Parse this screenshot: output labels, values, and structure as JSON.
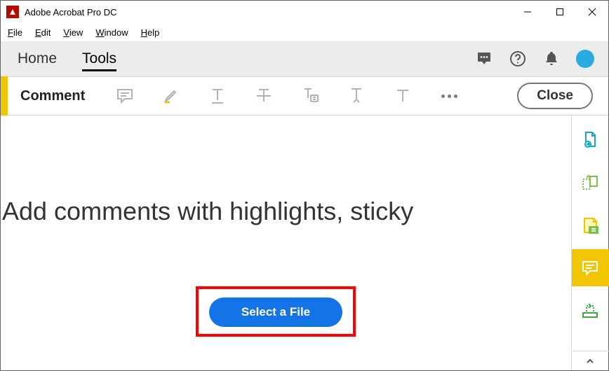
{
  "window": {
    "title": "Adobe Acrobat Pro DC"
  },
  "menubar": {
    "items": [
      "File",
      "Edit",
      "View",
      "Window",
      "Help"
    ]
  },
  "tabs": {
    "home": "Home",
    "tools": "Tools"
  },
  "toolbar": {
    "label": "Comment",
    "close_label": "Close"
  },
  "main": {
    "headline": "Add comments with highlights, sticky",
    "select_file_label": "Select a File"
  },
  "icons": {
    "notifications": "notifications-icon",
    "help": "help-icon",
    "bell": "bell-icon",
    "avatar": "avatar",
    "sticky": "sticky-note-icon",
    "highlighter": "highlighter-icon",
    "text": "text-icon",
    "strike": "strikethrough-icon",
    "textbox": "text-callout-icon",
    "textcaret": "text-insert-icon",
    "textT": "text-plain-icon",
    "more": "more-icon"
  },
  "sidebar": {
    "items": [
      "export-pdf",
      "organize-pages",
      "fill-sign",
      "comment",
      "stamp"
    ]
  },
  "colors": {
    "accent_yellow": "#f0c600",
    "accent_blue": "#1473e6",
    "highlight_red": "#ff0000",
    "avatar_blue": "#29abe2"
  }
}
